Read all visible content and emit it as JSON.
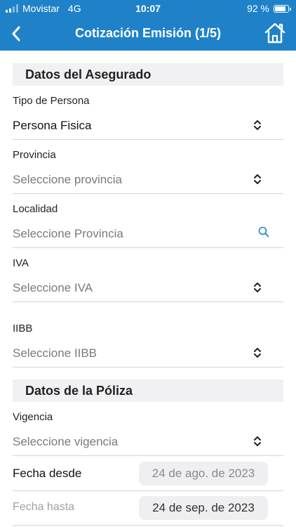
{
  "status": {
    "carrier": "Movistar",
    "network": "4G",
    "time": "10:07",
    "battery": "92 %",
    "battery_level": 0.92
  },
  "nav": {
    "title": "Cotización Emisión (1/5)",
    "back_icon": "chevron-left-icon",
    "home_icon": "home-icon"
  },
  "colors": {
    "brand": "#1f82c9",
    "accent_icon": "#1f82c9",
    "section_bg": "#f1f1f3"
  },
  "sections": {
    "insured": "Datos del Asegurado",
    "policy": "Datos de la Póliza"
  },
  "fields": {
    "tipo_persona": {
      "label": "Tipo de Persona",
      "value": "Persona Fisica"
    },
    "provincia": {
      "label": "Provincia",
      "placeholder": "Seleccione provincia"
    },
    "localidad": {
      "label": "Localidad",
      "placeholder": "Seleccione Provincia"
    },
    "iva": {
      "label": "IVA",
      "placeholder": "Seleccione IVA"
    },
    "iibb": {
      "label": "IIBB",
      "placeholder": "Seleccione IIBB"
    },
    "vigencia": {
      "label": "Vigencia",
      "placeholder": "Seleccione vigencia"
    },
    "fecha_desde": {
      "label": "Fecha desde",
      "value": "24 de ago. de 2023"
    },
    "fecha_hasta": {
      "label": "Fecha hasta",
      "value": "24 de sep. de 2023"
    }
  }
}
